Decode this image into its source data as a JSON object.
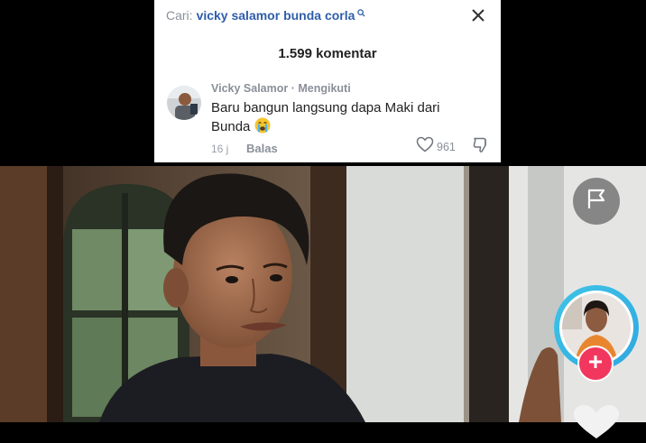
{
  "search": {
    "label": "Cari:",
    "query": "vicky salamor bunda corla"
  },
  "comments": {
    "count_label": "1.599 komentar"
  },
  "comment": {
    "author": "Vicky Salamor",
    "separator": " · ",
    "relation": "Mengikuti",
    "text": "Baru bangun langsung dapa Maki dari Bunda",
    "emoji": "crying-emoji",
    "time": "16 j",
    "reply_label": "Balas",
    "likes": "961"
  },
  "colors": {
    "accent_link": "#2f5eaa",
    "follow_button": "#f2375f",
    "avatar_ring": "#3fc3e6"
  },
  "icons": {
    "close": "close-icon",
    "search": "search-icon",
    "like": "heart-outline-icon",
    "dislike": "thumbs-down-icon",
    "report": "flag-icon",
    "follow": "plus-icon"
  }
}
